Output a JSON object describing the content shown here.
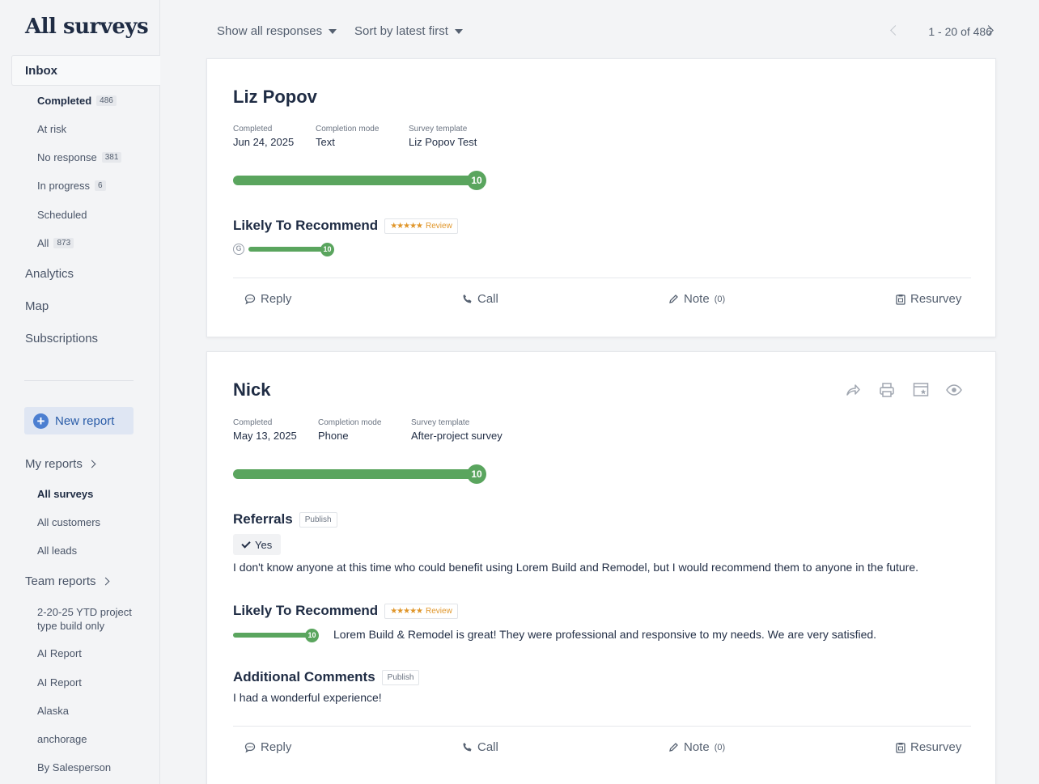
{
  "sidebar": {
    "title": "All surveys",
    "inbox": "Inbox",
    "inbox_items": [
      {
        "label": "Completed",
        "count": "486"
      },
      {
        "label": "At risk",
        "count": ""
      },
      {
        "label": "No response",
        "count": "381"
      },
      {
        "label": "In progress",
        "count": "6"
      },
      {
        "label": "Scheduled",
        "count": ""
      },
      {
        "label": "All",
        "count": "873"
      }
    ],
    "nav": [
      "Analytics",
      "Map",
      "Subscriptions"
    ],
    "new_report": "New report",
    "my_reports": "My reports",
    "my_reports_items": [
      "All surveys",
      "All customers",
      "All leads"
    ],
    "team_reports": "Team reports",
    "team_reports_items": [
      "2-20-25 YTD project type build only",
      "AI Report",
      "AI Report",
      "Alaska",
      "anchorage",
      "By Salesperson"
    ]
  },
  "toolbar": {
    "filter": "Show all responses",
    "sort": "Sort by latest first",
    "pager": "1 - 20 of 486"
  },
  "cards": [
    {
      "name": "Liz Popov",
      "meta": [
        {
          "label": "Completed",
          "value": "Jun 24, 2025"
        },
        {
          "label": "Completion mode",
          "value": "Text"
        },
        {
          "label": "Survey template",
          "value": "Liz Popov Test"
        }
      ],
      "score": "10",
      "score_fraction": 1.0,
      "questions": [
        {
          "title": "Likely To Recommend",
          "tag": "Review",
          "score": "10",
          "icon": "google-icon"
        }
      ],
      "actions": {
        "reply": "Reply",
        "call": "Call",
        "note": "Note",
        "note_count": "(0)",
        "resurvey": "Resurvey"
      }
    },
    {
      "name": "Nick",
      "meta": [
        {
          "label": "Completed",
          "value": "May 13, 2025"
        },
        {
          "label": "Completion mode",
          "value": "Phone"
        },
        {
          "label": "Survey template",
          "value": "After-project survey"
        }
      ],
      "score": "10",
      "score_fraction": 1.0,
      "questions": [
        {
          "title": "Referrals",
          "tag": "Publish",
          "answer": "Yes",
          "text": "I don't know anyone at this time who could benefit using Lorem Build and Remodel, but I would recommend them to anyone in the future."
        },
        {
          "title": "Likely To Recommend",
          "tag": "Review",
          "score": "10",
          "text": "Lorem Build & Remodel is great! They were professional and responsive to my needs. We are very satisfied."
        },
        {
          "title": "Additional Comments",
          "tag": "Publish",
          "text": "I had a wonderful experience!"
        }
      ],
      "tools": [
        "share-icon",
        "print-icon",
        "bookmark-icon",
        "view-icon"
      ],
      "actions": {
        "reply": "Reply",
        "call": "Call",
        "note": "Note",
        "note_count": "(0)",
        "resurvey": "Resurvey"
      }
    }
  ]
}
